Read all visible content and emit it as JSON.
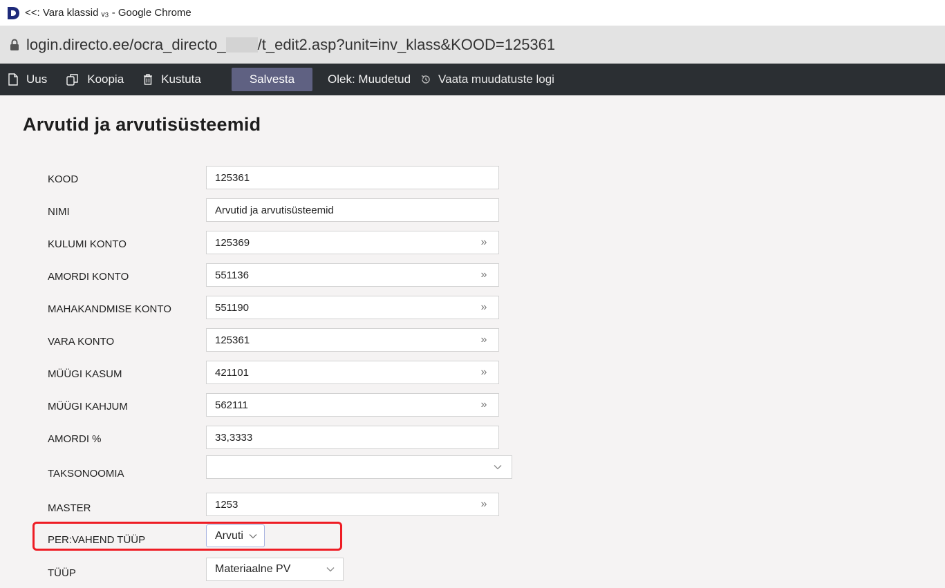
{
  "window": {
    "title": "<<: Vara klassid ᵥ₃ - Google Chrome"
  },
  "address": {
    "url_part1": "login.directo.ee/ocra_directo_",
    "url_part2": "/t_edit2.asp?unit=inv_klass&KOOD=125361"
  },
  "toolbar": {
    "new_label": "Uus",
    "copy_label": "Koopia",
    "delete_label": "Kustuta",
    "save_label": "Salvesta",
    "state_label": "Olek: Muudetud",
    "log_label": "Vaata muudatuste logi"
  },
  "page": {
    "title": "Arvutid ja arvutisüsteemid"
  },
  "form": {
    "kood": {
      "label": "KOOD",
      "value": "125361"
    },
    "nimi": {
      "label": "NIMI",
      "value": "Arvutid ja arvutisüsteemid"
    },
    "kulumi_konto": {
      "label": "KULUMI KONTO",
      "value": "125369"
    },
    "amordi_konto": {
      "label": "AMORDI KONTO",
      "value": "551136"
    },
    "mahakandmise_konto": {
      "label": "MAHAKANDMISE KONTO",
      "value": "551190"
    },
    "vara_konto": {
      "label": "VARA KONTO",
      "value": "125361"
    },
    "myygi_kasum": {
      "label": "MÜÜGI KASUM",
      "value": "421101"
    },
    "myygi_kahjum": {
      "label": "MÜÜGI KAHJUM",
      "value": "562111"
    },
    "amordi_pct": {
      "label": "AMORDI %",
      "value": "33,3333"
    },
    "taksonoomia": {
      "label": "TAKSONOOMIA",
      "value": ""
    },
    "master": {
      "label": "MASTER",
      "value": "1253"
    },
    "per_vahend_tyyp": {
      "label": "PER:VAHEND TÜÜP",
      "value": "Arvuti"
    },
    "tyyp": {
      "label": "TÜÜP",
      "value": "Materiaalne PV"
    }
  },
  "icons": {
    "lookup": "»",
    "chevron": "⌄"
  },
  "colors": {
    "toolbar_bg": "#2b2f33",
    "save_bg": "#5f6182",
    "highlight": "#ee1c24"
  }
}
